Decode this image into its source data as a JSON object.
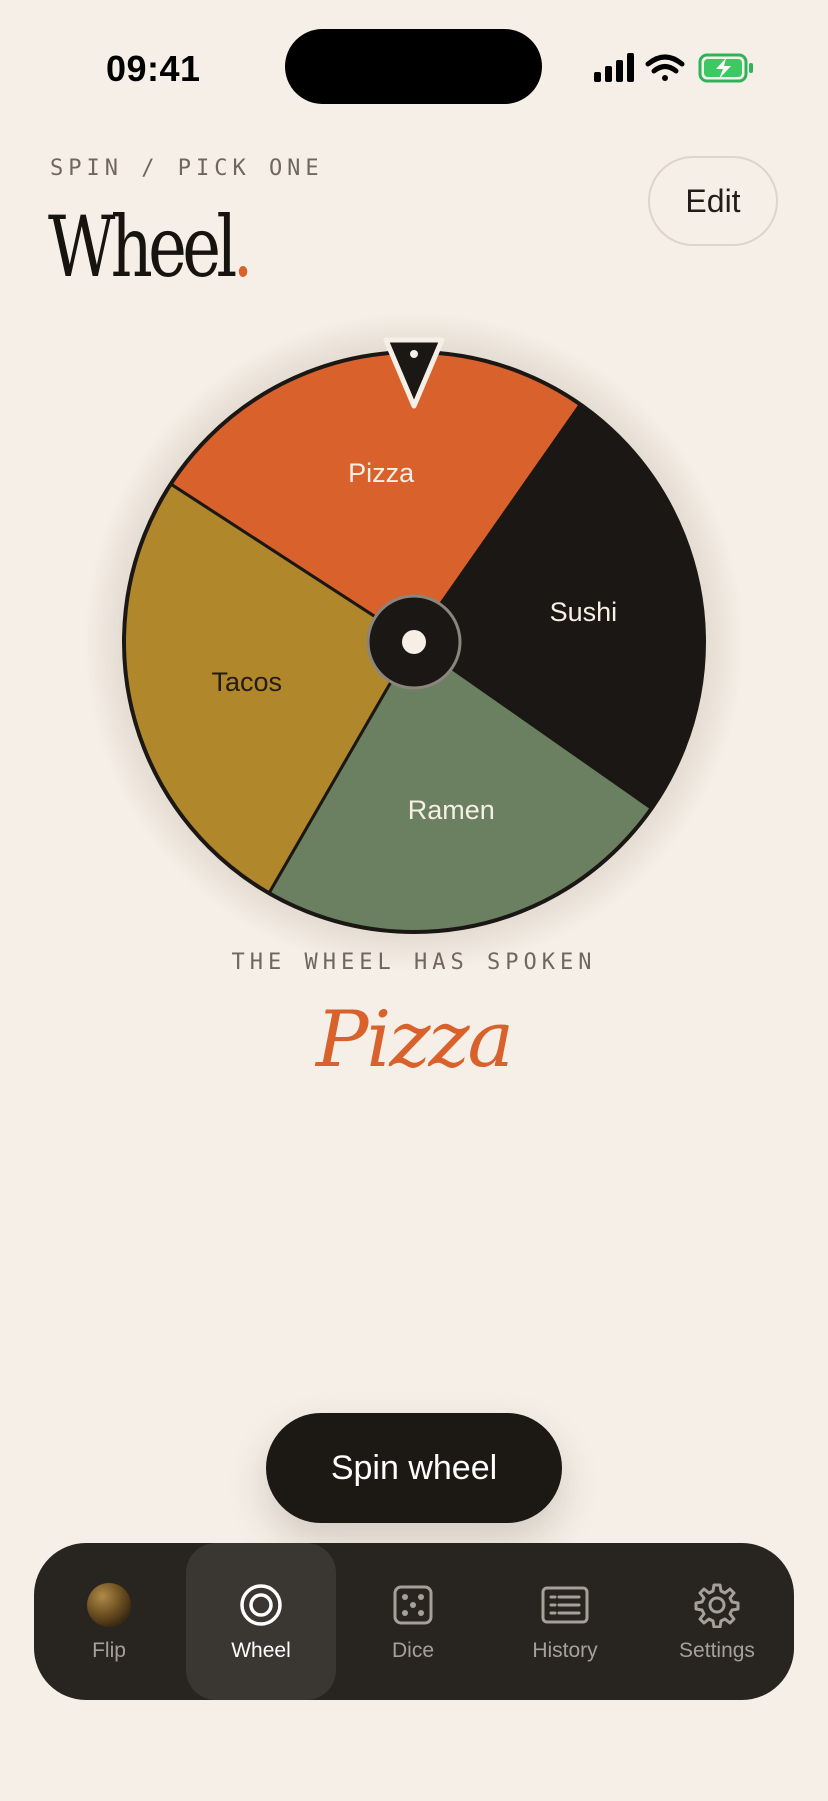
{
  "status": {
    "time": "09:41"
  },
  "header": {
    "eyebrow": "SPIN / PICK ONE",
    "title": "Wheel",
    "title_dot": ".",
    "edit_label": "Edit"
  },
  "wheel": {
    "segments": [
      {
        "label": "Pizza",
        "color": "#d8612c",
        "text_color": "#f7efe5"
      },
      {
        "label": "Sushi",
        "color": "#1b1714",
        "text_color": "#f7efe5"
      },
      {
        "label": "Ramen",
        "color": "#6b8060",
        "text_color": "#f7efe5"
      },
      {
        "label": "Tacos",
        "color": "#b0872b",
        "text_color": "#241c12"
      }
    ]
  },
  "result": {
    "caption": "THE WHEEL HAS SPOKEN",
    "value": "Pizza"
  },
  "spin_label": "Spin wheel",
  "tabs": [
    {
      "label": "Flip",
      "icon": "coin-icon",
      "active": false
    },
    {
      "label": "Wheel",
      "icon": "wheel-icon",
      "active": true
    },
    {
      "label": "Dice",
      "icon": "dice-icon",
      "active": false
    },
    {
      "label": "History",
      "icon": "history-list-icon",
      "active": false
    },
    {
      "label": "Settings",
      "icon": "gear-icon",
      "active": false
    }
  ],
  "colors": {
    "accent": "#d8612c",
    "background": "#f5efe7",
    "ink": "#1b1714"
  }
}
